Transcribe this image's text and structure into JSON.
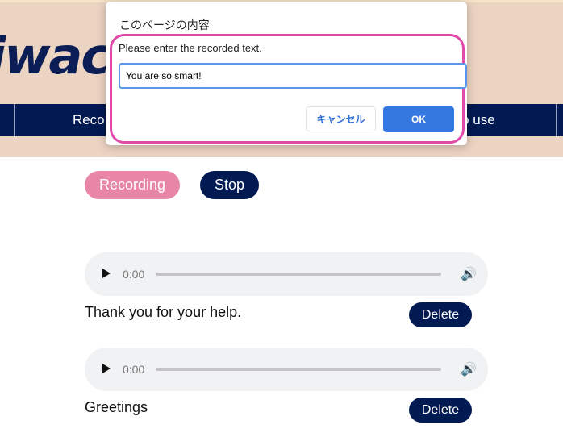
{
  "header": {
    "logo": "iwaco",
    "nav": [
      "",
      "Reco",
      "to use",
      ""
    ]
  },
  "controls": {
    "record": "Recording",
    "stop": "Stop",
    "record_color": "#e886a8",
    "stop_color": "#021a52"
  },
  "recordings": [
    {
      "time": "0:00",
      "text": "Thank you for your help.",
      "delete": "Delete"
    },
    {
      "time": "0:00",
      "text": "Greetings",
      "delete": "Delete"
    }
  ],
  "dialog": {
    "title": "このページの内容",
    "message": "Please enter the recorded text.",
    "value": "You are so smart!",
    "cancel": "キャンセル",
    "ok": "OK"
  }
}
